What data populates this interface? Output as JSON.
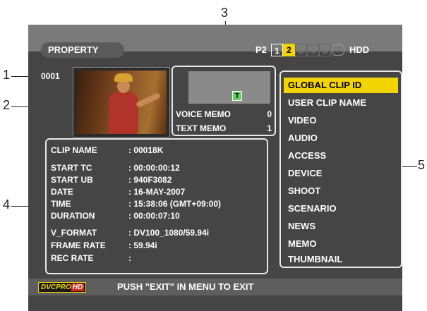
{
  "callouts": [
    "1",
    "2",
    "3",
    "4",
    "5"
  ],
  "header": {
    "title": "PROPERTY",
    "p2_label": "P2",
    "slots": [
      "1",
      "2",
      "3",
      "4",
      "5"
    ],
    "hdd_label": "HDD"
  },
  "clip": {
    "number": "0001"
  },
  "memo": {
    "text_badge": "T",
    "voice_label": "VOICE MEMO",
    "voice_count": "0",
    "text_label": "TEXT MEMO",
    "text_count": "1"
  },
  "info": [
    {
      "key": "CLIP NAME",
      "value": ": 00018K"
    },
    {
      "key": "START TC",
      "value": ": 00:00:00:12"
    },
    {
      "key": "START UB",
      "value": ": 940F3082"
    },
    {
      "key": "DATE",
      "value": ": 16-MAY-2007"
    },
    {
      "key": "TIME",
      "value": ": 15:38:06 (GMT+09:00)"
    },
    {
      "key": "DURATION",
      "value": ": 00:00:07:10"
    },
    {
      "key": "V_FORMAT",
      "value": ": DV100_1080/59.94i"
    },
    {
      "key": "FRAME RATE",
      "value": ": 59.94i"
    },
    {
      "key": "REC RATE",
      "value": ":"
    }
  ],
  "menu": [
    "GLOBAL CLIP ID",
    "USER CLIP NAME",
    "VIDEO",
    "AUDIO",
    "ACCESS",
    "DEVICE",
    "SHOOT",
    "SCENARIO",
    "NEWS",
    "MEMO",
    "THUMBNAIL"
  ],
  "footer": {
    "format_logo_prefix": "DVCPRO",
    "format_logo_suffix": "HD",
    "message": "PUSH \"EXIT\" IN MENU TO EXIT"
  },
  "colors": {
    "highlight": "#f2d400",
    "screen_bg": "#454545",
    "memo_indicator": "#5fd35f"
  },
  "icons": [
    "hdd-cylinder-icon",
    "text-memo-icon",
    "dvcpro-hd-logo"
  ]
}
